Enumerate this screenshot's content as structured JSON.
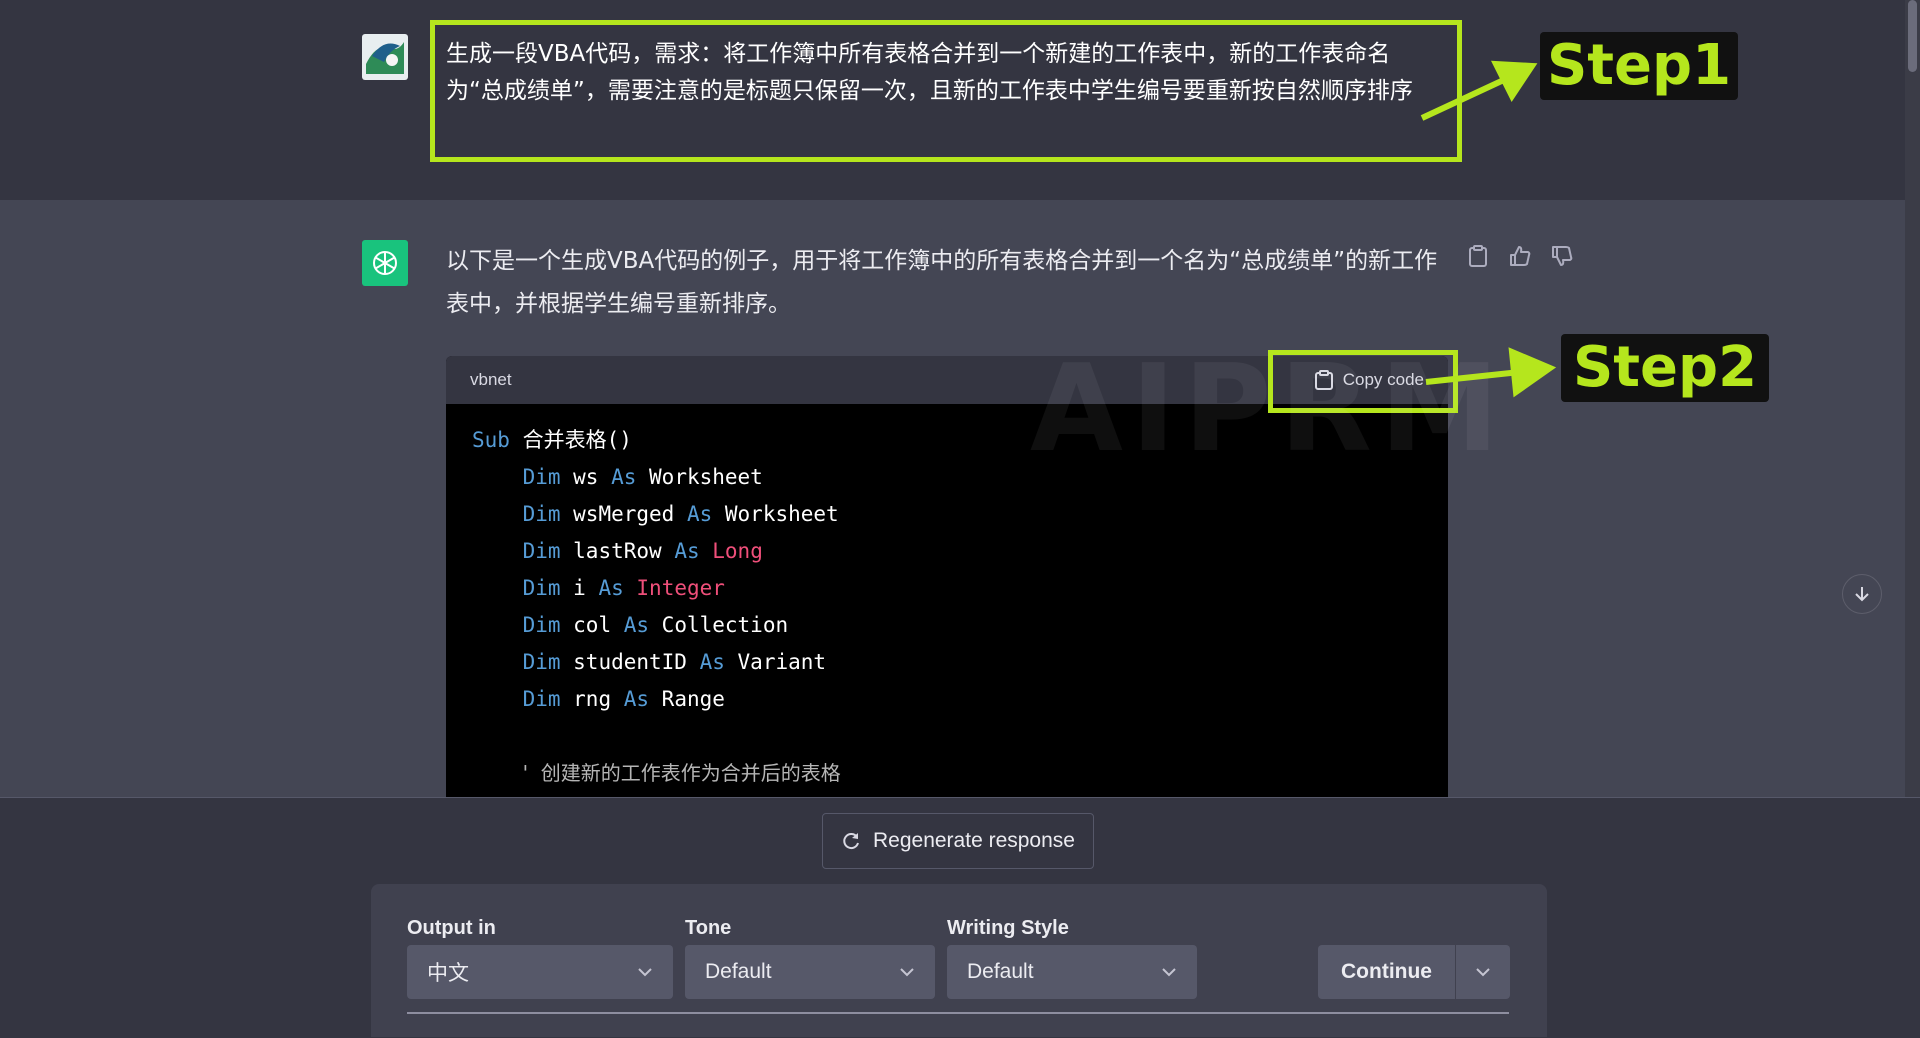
{
  "user_message": {
    "text": "生成一段VBA代码，需求：将工作簿中所有表格合并到一个新建的工作表中，新的工作表命名为“总成绩单”，需要注意的是标题只保留一次，且新的工作表中学生编号要重新按自然顺序排序"
  },
  "assistant_message": {
    "text": "以下是一个生成VBA代码的例子，用于将工作簿中的所有表格合并到一个名为“总成绩单”的新工作表中，并根据学生编号重新排序。"
  },
  "annotations": {
    "step1": "Step1",
    "step2": "Step2",
    "accent_color": "#b5e61d"
  },
  "code_block": {
    "language": "vbnet",
    "copy_label": "Copy code",
    "lines": [
      {
        "indent": 0,
        "parts": [
          [
            "kw",
            "Sub"
          ],
          [
            "tx",
            " 合并表格()"
          ]
        ]
      },
      {
        "indent": 1,
        "parts": [
          [
            "kw",
            "Dim"
          ],
          [
            "tx",
            " ws "
          ],
          [
            "kw",
            "As"
          ],
          [
            "tx",
            " Worksheet"
          ]
        ]
      },
      {
        "indent": 1,
        "parts": [
          [
            "kw",
            "Dim"
          ],
          [
            "tx",
            " wsMerged "
          ],
          [
            "kw",
            "As"
          ],
          [
            "tx",
            " Worksheet"
          ]
        ]
      },
      {
        "indent": 1,
        "parts": [
          [
            "kw",
            "Dim"
          ],
          [
            "tx",
            " lastRow "
          ],
          [
            "kw",
            "As"
          ],
          [
            "tx",
            " "
          ],
          [
            "ty",
            "Long"
          ]
        ]
      },
      {
        "indent": 1,
        "parts": [
          [
            "kw",
            "Dim"
          ],
          [
            "tx",
            " i "
          ],
          [
            "kw",
            "As"
          ],
          [
            "tx",
            " "
          ],
          [
            "ty",
            "Integer"
          ]
        ]
      },
      {
        "indent": 1,
        "parts": [
          [
            "kw",
            "Dim"
          ],
          [
            "tx",
            " col "
          ],
          [
            "kw",
            "As"
          ],
          [
            "tx",
            " Collection"
          ]
        ]
      },
      {
        "indent": 1,
        "parts": [
          [
            "kw",
            "Dim"
          ],
          [
            "tx",
            " studentID "
          ],
          [
            "kw",
            "As"
          ],
          [
            "tx",
            " Variant"
          ]
        ]
      },
      {
        "indent": 1,
        "parts": [
          [
            "kw",
            "Dim"
          ],
          [
            "tx",
            " rng "
          ],
          [
            "kw",
            "As"
          ],
          [
            "tx",
            " Range"
          ]
        ]
      },
      {
        "indent": 1,
        "parts": []
      },
      {
        "indent": 1,
        "parts": [
          [
            "cm",
            "'  创建新的工作表作为合并后的表格"
          ]
        ]
      }
    ]
  },
  "watermark": "AIPRM",
  "regenerate_label": "Regenerate response",
  "options": {
    "output_in": {
      "label": "Output in",
      "value": "中文"
    },
    "tone": {
      "label": "Tone",
      "value": "Default"
    },
    "writing_style": {
      "label": "Writing Style",
      "value": "Default"
    },
    "continue_label": "Continue"
  }
}
